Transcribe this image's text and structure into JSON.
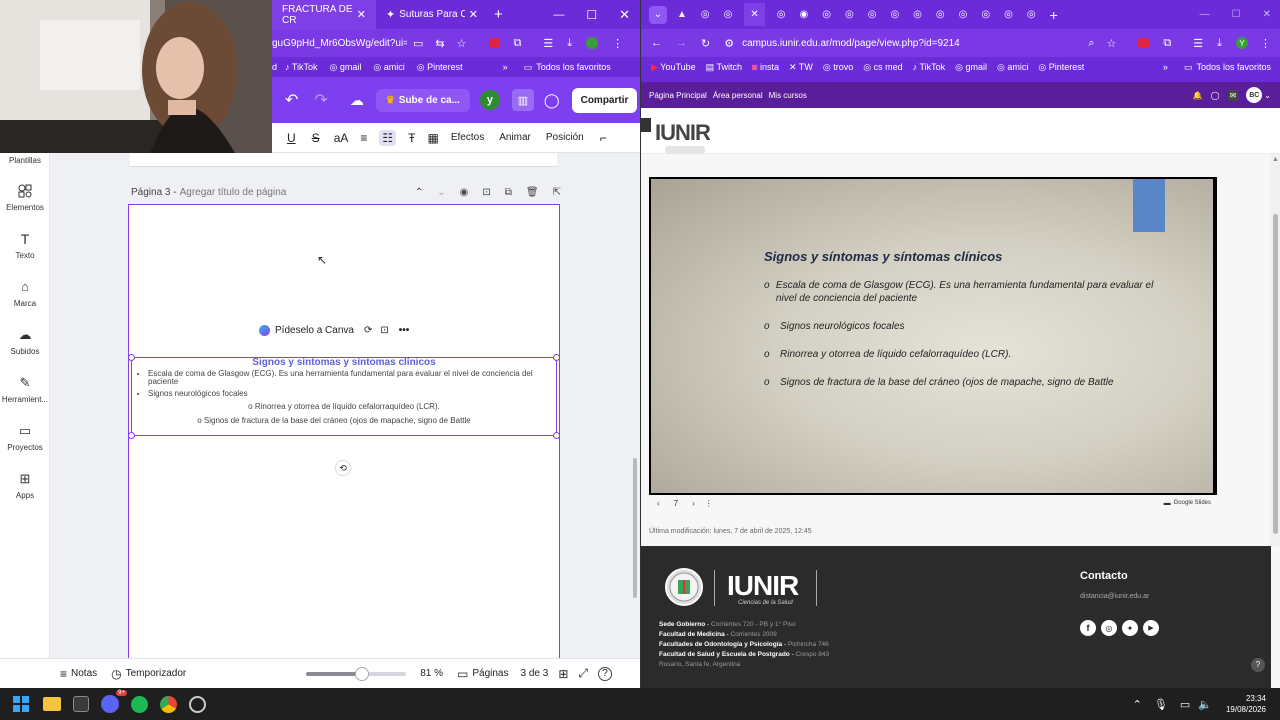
{
  "left_browser": {
    "tabs": [
      {
        "label": "FRACTURA DE CR",
        "active": true
      },
      {
        "label": "Suturas Para Cada",
        "active": false
      }
    ],
    "url": "guG9pHd_Mr6ObsWg/edit?ui=...",
    "bookmarks": [
      "d",
      "TikTok",
      "gmail",
      "amici",
      "Pinterest"
    ],
    "all_bookmarks": "Todos los favoritos"
  },
  "canva": {
    "upgrade_label": "Sube de ca...",
    "avatar_letter": "y",
    "share_label": "Compartir",
    "format_toolbar": [
      "Efectos",
      "Animar",
      "Posición"
    ],
    "sidebar_items": [
      "Plantillas",
      "Elementos",
      "Texto",
      "Marca",
      "Subidos",
      "Herramient...",
      "Proyectos",
      "Apps"
    ],
    "page_label": "Página 3 -",
    "page_title_placeholder": "Agregar título de página",
    "ask_canva": "Pídeselo a Canva",
    "textbox": {
      "heading": "Signos y síntomas y síntomas clínicos",
      "bullets": [
        "Escala de coma de Glasgow (ECG). Es una herramienta fundamental para evaluar el nivel de conciencia del paciente",
        "Signos neurológicos focales"
      ],
      "centered_lines": [
        "o Rinorrea y otorrea de líquido cefalorraquídeo (LCR).",
        "o Signos de fractura de la base del cráneo (ojos de mapache, signo de Battle"
      ]
    },
    "bottom": {
      "notes": "Notas",
      "timer": "Temporizador",
      "zoom_value": 0.81,
      "zoom": "81 %",
      "pages_label": "Páginas",
      "pages": "3 de 3"
    }
  },
  "right_browser": {
    "url": "campus.iunir.edu.ar/mod/page/view.php?id=9214",
    "bookmarks": [
      "YouTube",
      "Twitch",
      "insta",
      "TW",
      "trovo",
      "cs med",
      "TikTok",
      "gmail",
      "amici",
      "Pinterest"
    ],
    "all_bookmarks": "Todos los favoritos",
    "avatar_letter": "Y"
  },
  "moodle": {
    "nav": [
      "Página Principal",
      "Área personal",
      "Mis cursos"
    ],
    "user_initials": "BC",
    "logo_text": "IUNIR",
    "slide": {
      "title": "Signos y síntomas y síntomas clínicos",
      "items": [
        "Escala de coma de Glasgow (ECG). Es una herramienta fundamental para evaluar el nivel de conciencia del paciente",
        "Signos neurológicos focales",
        "Rinorrea y otorrea de líquido cefalorraquídeo (LCR).",
        "Signos de fractura de la base del cráneo (ojos de mapache, signo de Battle"
      ],
      "page_number": "7",
      "provider": "Google Slides"
    },
    "last_modified": "Última modificación: lunes, 7 de abril de 2025, 12:45",
    "footer": {
      "logo_text": "IUNIR",
      "logo_sub": "Ciencias de la Salud",
      "contact_title": "Contacto",
      "contact_email": "distancia@iunir.edu.ar",
      "addresses": [
        {
          "name": "Sede Gobierno",
          "addr": "Corrientes 720 - PB y 1° Piso"
        },
        {
          "name": "Facultad de Medicina",
          "addr": "Corrientes 2009"
        },
        {
          "name": "Facultades de Odontología y Psicología",
          "addr": "Pichincha 746"
        },
        {
          "name": "Facultad de Salud y Escuela de Postgrado",
          "addr": "Crespo 843"
        }
      ],
      "city": "Rosario, Santa fe, Argentina"
    }
  },
  "taskbar": {
    "time": "23:34",
    "date": "19/08/2026",
    "badge": "9+"
  },
  "colors": {
    "browser_purple": "#6c2bd9",
    "canva_purple": "#7d3ff0",
    "selection": "#8b3fe6",
    "heading_blue": "#5b63d6",
    "footer_bg": "#2b2b2b"
  }
}
